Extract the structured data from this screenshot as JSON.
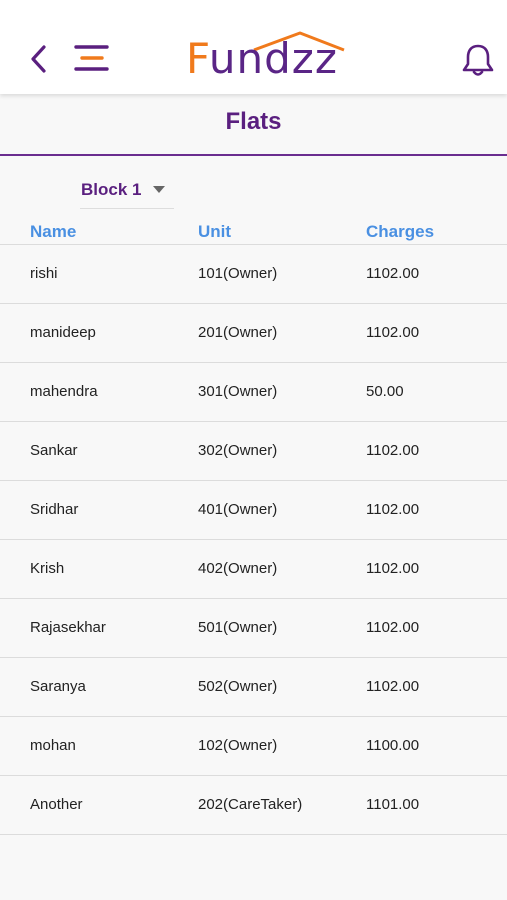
{
  "header": {
    "logo_first": "F",
    "logo_rest": "undzz"
  },
  "page": {
    "title": "Flats"
  },
  "filter": {
    "selected": "Block 1"
  },
  "table": {
    "columns": [
      "Name",
      "Unit",
      "Charges"
    ],
    "rows": [
      {
        "name": "rishi",
        "unit": "101(Owner)",
        "charges": "1102.00"
      },
      {
        "name": "manideep",
        "unit": "201(Owner)",
        "charges": "1102.00"
      },
      {
        "name": "mahendra",
        "unit": "301(Owner)",
        "charges": "50.00"
      },
      {
        "name": "Sankar",
        "unit": "302(Owner)",
        "charges": "1102.00"
      },
      {
        "name": "Sridhar",
        "unit": "401(Owner)",
        "charges": "1102.00"
      },
      {
        "name": "Krish",
        "unit": "402(Owner)",
        "charges": "1102.00"
      },
      {
        "name": "Rajasekhar",
        "unit": "501(Owner)",
        "charges": "1102.00"
      },
      {
        "name": "Saranya",
        "unit": "502(Owner)",
        "charges": "1102.00"
      },
      {
        "name": "mohan",
        "unit": "102(Owner)",
        "charges": "1100.00"
      },
      {
        "name": "Another",
        "unit": "202(CareTaker)",
        "charges": "1101.00"
      }
    ]
  },
  "icons": {
    "back": "chevron-left-icon",
    "menu": "hamburger-menu-icon",
    "notifications": "bell-icon",
    "dropdown": "caret-down-icon"
  },
  "colors": {
    "brand_purple": "#5a1f7f",
    "brand_orange": "#f07a1c",
    "header_blue": "#4a90e2"
  }
}
